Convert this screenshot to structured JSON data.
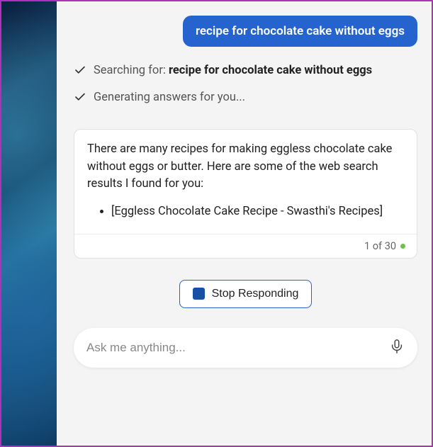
{
  "user_message": {
    "text": "recipe for chocolate cake without eggs"
  },
  "status": {
    "searching_prefix": "Searching for: ",
    "searching_query": "recipe for chocolate cake without eggs",
    "generating_text": "Generating answers for you..."
  },
  "answer": {
    "intro": "There are many recipes for making eggless chocolate cake without eggs or butter. Here are some of the web search results I found for you:",
    "results": [
      "[Eggless Chocolate Cake Recipe - Swasthi's Recipes]"
    ],
    "footer_counter": "1 of 30"
  },
  "actions": {
    "stop_label": "Stop Responding"
  },
  "input": {
    "placeholder": "Ask me anything..."
  }
}
